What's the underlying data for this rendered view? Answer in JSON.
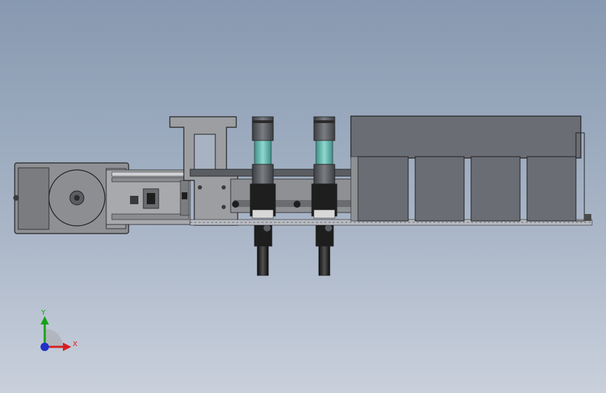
{
  "scene": {
    "model": "cad-assembly-front-view",
    "colors": {
      "background_top": "#8799b0",
      "background_bottom": "#c9d0dc",
      "metal": "#8f8f92",
      "metal_dark": "#5a5d62",
      "housing": "#6a6d73",
      "glass": "#5fb6ad",
      "black": "#1e1e1e",
      "outline": "#202020"
    }
  },
  "triad": {
    "x_label": "X",
    "y_label": "Y",
    "x_color": "#d42020",
    "y_color": "#18a018",
    "z_color": "#2030c8"
  }
}
